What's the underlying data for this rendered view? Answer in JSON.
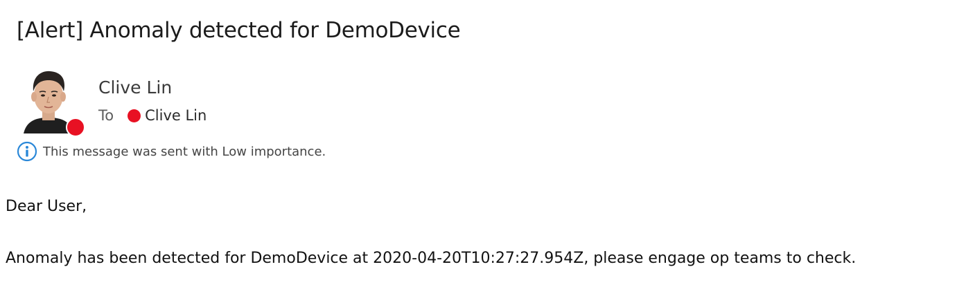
{
  "email": {
    "subject": "[Alert] Anomaly detected for DemoDevice",
    "sender": {
      "name": "Clive Lin",
      "avatar_icon": "person-photo-avatar",
      "presence_color": "#e81123"
    },
    "to_label": "To",
    "recipients": [
      {
        "name": "Clive Lin",
        "presence_color": "#e81123"
      }
    ],
    "importance_notice": "This message was sent with Low importance.",
    "info_icon": "info-icon",
    "body": {
      "greeting": "Dear User,",
      "message": "Anomaly has been detected for DemoDevice at 2020-04-20T10:27:27.954Z, please engage op teams to check."
    }
  }
}
